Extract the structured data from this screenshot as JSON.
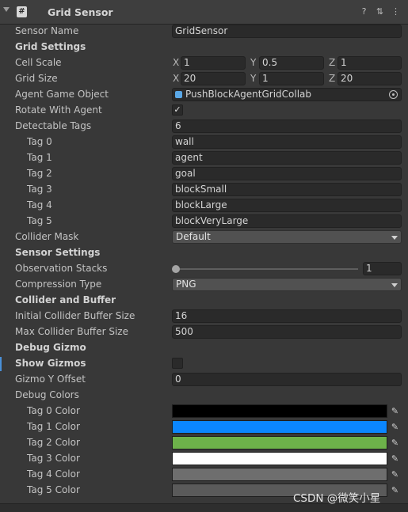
{
  "component": {
    "title": "Grid Sensor"
  },
  "fields": {
    "sensor_name": {
      "label": "Sensor Name",
      "value": "GridSensor"
    },
    "grid_settings": "Grid Settings",
    "cell_scale": {
      "label": "Cell Scale",
      "x": "1",
      "y": "0.5",
      "z": "1"
    },
    "grid_size": {
      "label": "Grid Size",
      "x": "20",
      "y": "1",
      "z": "20"
    },
    "agent_game_object": {
      "label": "Agent Game Object",
      "value": "PushBlockAgentGridCollab"
    },
    "rotate_with_agent": {
      "label": "Rotate With Agent",
      "checked": "✓"
    },
    "detectable_tags": {
      "label": "Detectable Tags",
      "value": "6"
    },
    "tags": [
      {
        "label": "Tag 0",
        "value": "wall"
      },
      {
        "label": "Tag 1",
        "value": "agent"
      },
      {
        "label": "Tag 2",
        "value": "goal"
      },
      {
        "label": "Tag 3",
        "value": "blockSmall"
      },
      {
        "label": "Tag 4",
        "value": "blockLarge"
      },
      {
        "label": "Tag 5",
        "value": "blockVeryLarge"
      }
    ],
    "collider_mask": {
      "label": "Collider Mask",
      "value": "Default"
    },
    "sensor_settings": "Sensor Settings",
    "observation_stacks": {
      "label": "Observation Stacks",
      "value": "1",
      "slider_fraction": 0
    },
    "compression_type": {
      "label": "Compression Type",
      "value": "PNG"
    },
    "collider_and_buffer": "Collider and Buffer",
    "initial_collider_buffer_size": {
      "label": "Initial Collider Buffer Size",
      "value": "16"
    },
    "max_collider_buffer_size": {
      "label": "Max Collider Buffer Size",
      "value": "500"
    },
    "debug_gizmo": "Debug Gizmo",
    "show_gizmos": {
      "label": "Show Gizmos"
    },
    "gizmo_y_offset": {
      "label": "Gizmo Y Offset",
      "value": "0"
    },
    "debug_colors": {
      "label": "Debug Colors"
    },
    "tag_colors": [
      {
        "label": "Tag 0 Color",
        "color": "#000000"
      },
      {
        "label": "Tag 1 Color",
        "color": "#0b87ff"
      },
      {
        "label": "Tag 2 Color",
        "color": "#6db24a"
      },
      {
        "label": "Tag 3 Color",
        "color": "#ffffff"
      },
      {
        "label": "Tag 4 Color",
        "color": "#6e6e6e"
      },
      {
        "label": "Tag 5 Color",
        "color": "#5a5a5a"
      }
    ]
  },
  "axis_labels": {
    "x": "X",
    "y": "Y",
    "z": "Z"
  },
  "watermark": "CSDN @微笑小星"
}
